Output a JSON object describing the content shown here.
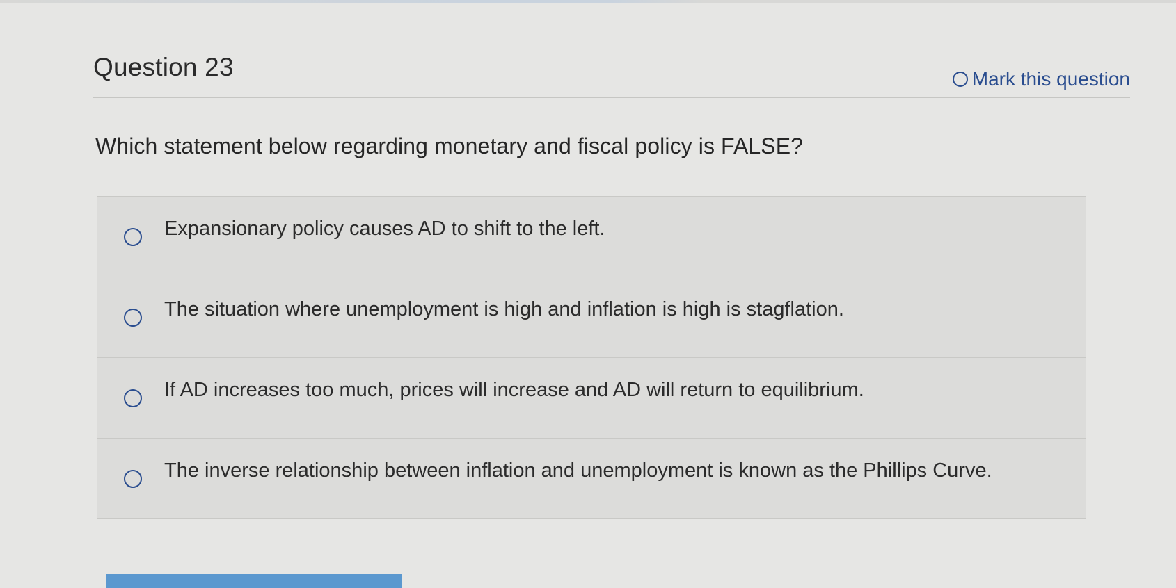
{
  "header": {
    "title": "Question 23",
    "mark_label": "Mark this question"
  },
  "question": {
    "prompt": "Which statement below regarding monetary and fiscal policy is FALSE?",
    "options": [
      {
        "label": "Expansionary policy causes AD to shift to the left."
      },
      {
        "label": "The situation where unemployment is high and inflation is high is stagflation."
      },
      {
        "label": "If AD increases too much, prices will increase and AD will return to equilibrium."
      },
      {
        "label": "The inverse relationship between inflation and unemployment is known as the Phillips Curve."
      }
    ]
  },
  "colors": {
    "accent": "#2a4d8f",
    "button": "#5b98cf",
    "background": "#e6e6e4",
    "option_background": "#dcdcda"
  },
  "icons": {
    "mark": "circle-outline-icon",
    "radio": "radio-unchecked-icon"
  }
}
